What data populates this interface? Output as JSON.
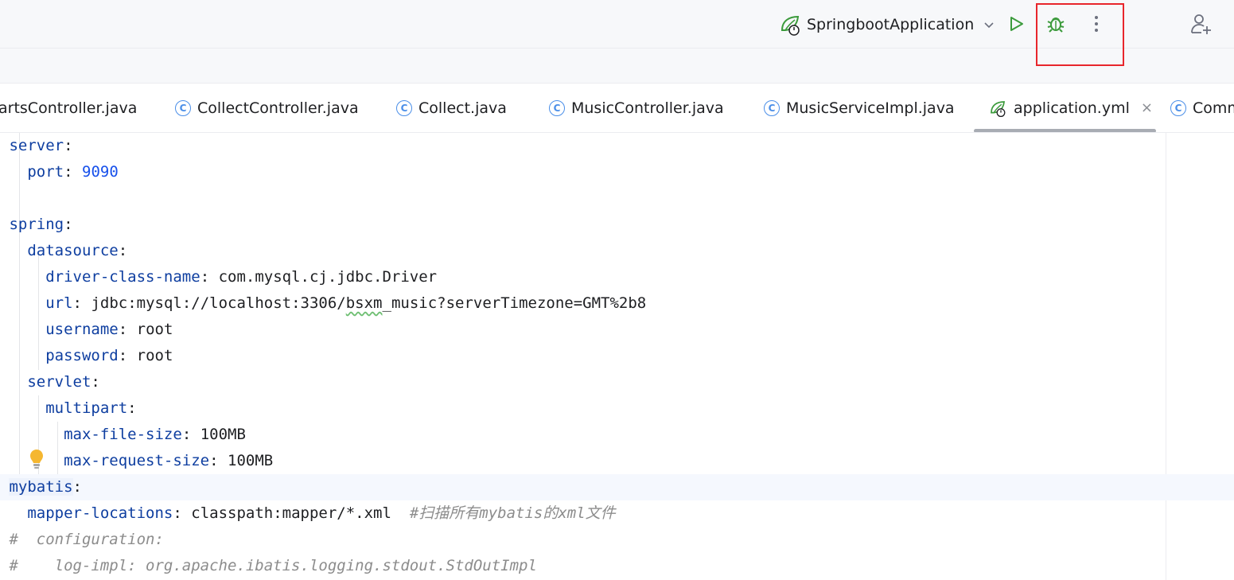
{
  "toolbar": {
    "run_config_label": "SpringbootApplication",
    "run_config_icon": "spring-boot-icon",
    "chevron_icon": "chevron-down-icon",
    "run_icon": "play-icon",
    "debug_icon": "bug-icon",
    "more_icon": "more-vertical-icon",
    "add_user_icon": "add-user-icon",
    "highlight_color": "#e8262c"
  },
  "tabs": [
    {
      "label": "artsController.java",
      "icon": "class-icon"
    },
    {
      "label": "CollectController.java",
      "icon": "class-icon"
    },
    {
      "label": "Collect.java",
      "icon": "class-icon"
    },
    {
      "label": "MusicController.java",
      "icon": "class-icon"
    },
    {
      "label": "MusicServiceImpl.java",
      "icon": "class-icon"
    },
    {
      "label": "application.yml",
      "icon": "spring-boot-icon",
      "active": true,
      "close": "×"
    },
    {
      "label": "Comm",
      "icon": "class-icon"
    }
  ],
  "class_icon_glyph": "C",
  "editor": {
    "lines": [
      {
        "key": "server",
        "sep": ":"
      },
      {
        "indent": "  ",
        "key": "port",
        "sep": ": ",
        "value": "9090"
      },
      {},
      {
        "key": "spring",
        "sep": ":"
      },
      {
        "indent": "  ",
        "key": "datasource",
        "sep": ":"
      },
      {
        "indent": "    ",
        "key": "driver-class-name",
        "sep": ": ",
        "value": "com.mysql.cj.jdbc.Driver"
      },
      {
        "indent": "    ",
        "key": "url",
        "sep": ": ",
        "value_a": "jdbc:mysql://localhost:3306/",
        "value_b": "bsxm",
        "value_c": "_music?serverTimezone=GMT%2b8"
      },
      {
        "indent": "    ",
        "key": "username",
        "sep": ": ",
        "value": "root"
      },
      {
        "indent": "    ",
        "key": "password",
        "sep": ": ",
        "value": "root"
      },
      {
        "indent": "  ",
        "key": "servlet",
        "sep": ":"
      },
      {
        "indent": "    ",
        "key": "multipart",
        "sep": ":"
      },
      {
        "indent": "      ",
        "key": "max-file-size",
        "sep": ": ",
        "value": "100MB"
      },
      {
        "indent": "      ",
        "key": "max-request-size",
        "sep": ": ",
        "value": "100MB"
      },
      {
        "key": "mybatis",
        "sep": ":"
      },
      {
        "indent": "  ",
        "key": "mapper-locations",
        "sep": ": ",
        "value": "classpath:mapper/*.xml",
        "comment": "  #扫描所有mybatis的xml文件"
      },
      {
        "comment": "#  configuration:"
      },
      {
        "comment": "#    log-impl: org.apache.ibatis.logging.stdout.StdOutImpl"
      }
    ]
  },
  "gutter": {
    "bulb_icon": "lightbulb-icon"
  }
}
